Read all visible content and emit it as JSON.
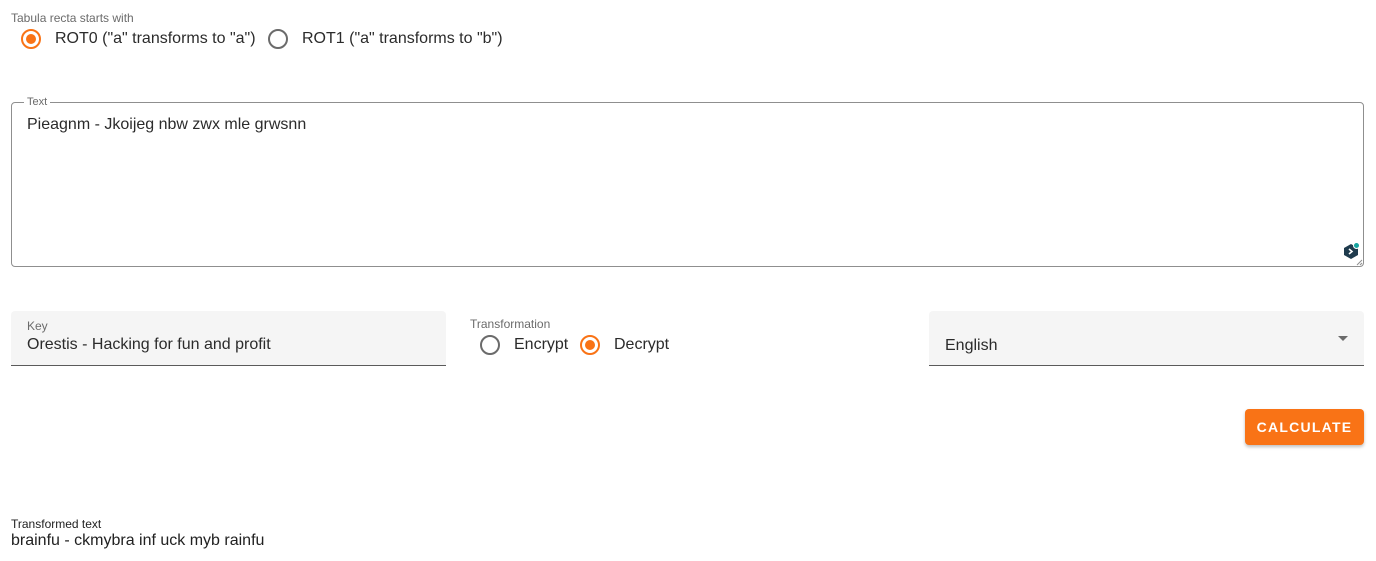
{
  "tabula_recta": {
    "label": "Tabula recta starts with",
    "options": [
      {
        "label": "ROT0 (\"a\" transforms to \"a\")",
        "checked": true
      },
      {
        "label": "ROT1 (\"a\" transforms to \"b\")",
        "checked": false
      }
    ]
  },
  "text_field": {
    "label": "Text",
    "value": "Pieagnm - Jkoijeg nbw zwx mle grwsnn"
  },
  "key_field": {
    "label": "Key",
    "value": "Orestis - Hacking for fun and profit"
  },
  "transformation": {
    "label": "Transformation",
    "options": [
      {
        "label": "Encrypt",
        "checked": false
      },
      {
        "label": "Decrypt",
        "checked": true
      }
    ]
  },
  "language_select": {
    "value": "English"
  },
  "calculate_button": {
    "label": "CALCULATE"
  },
  "result": {
    "label": "Transformed text",
    "value": "brainfu - ckmybra inf uck myb rainfu"
  },
  "colors": {
    "accent": "#f97316",
    "field_bg": "#f5f5f5"
  }
}
